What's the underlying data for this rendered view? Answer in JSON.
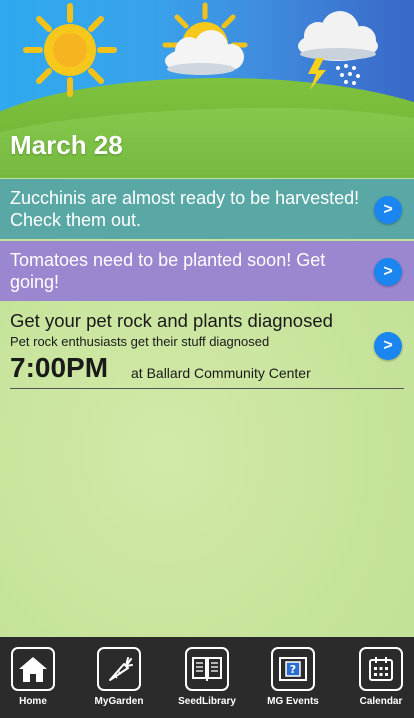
{
  "header": {
    "date": "March 28"
  },
  "banners": [
    {
      "text": "Zucchinis are almost ready to be harvested! Check them out.",
      "arrow": ">"
    },
    {
      "text": "Tomatoes need to be planted soon! Get going!",
      "arrow": ">"
    }
  ],
  "event": {
    "title": "Get your pet rock and plants diagnosed",
    "subtitle": "Pet rock enthusiasts get their stuff diagnosed",
    "time": "7:00PM",
    "location": "at Ballard Community Center",
    "arrow": ">"
  },
  "tabs": [
    {
      "label": "Home",
      "icon": "home-icon"
    },
    {
      "label": "MyGarden",
      "icon": "carrot-icon"
    },
    {
      "label": "SeedLibrary",
      "icon": "book-icon"
    },
    {
      "label": "MG Events",
      "icon": "help-screen-icon"
    },
    {
      "label": "Calendar",
      "icon": "calendar-icon"
    }
  ],
  "colors": {
    "accent_button": "#1b86f0",
    "banner_teal": "#5aa8a6",
    "banner_purple": "#9b86d0",
    "tabbar": "#2b2b2b"
  }
}
